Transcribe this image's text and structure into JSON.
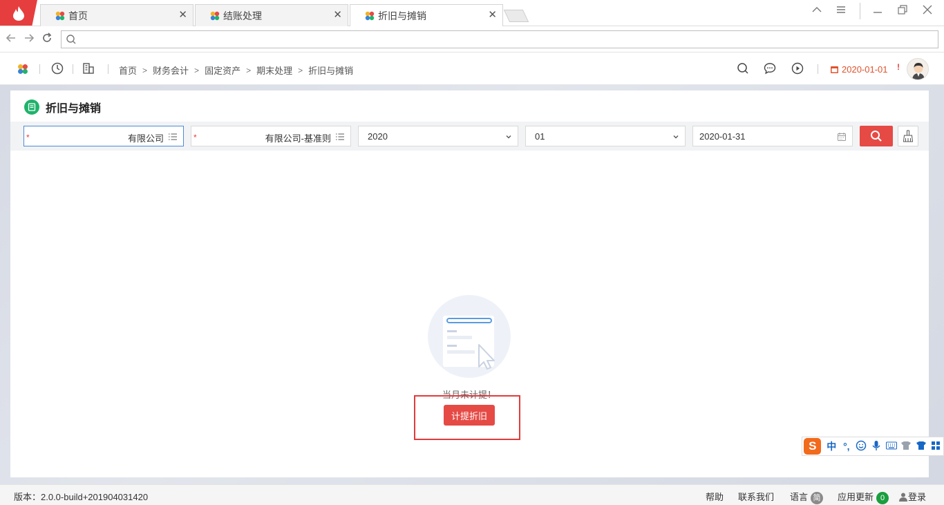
{
  "tabs": [
    {
      "label": "首页",
      "active": false
    },
    {
      "label": "结账处理",
      "active": false
    },
    {
      "label": "折旧与摊销",
      "active": true
    }
  ],
  "address": {
    "value": "",
    "placeholder": ""
  },
  "breadcrumb": [
    "首页",
    "财务会计",
    "固定资产",
    "期末处理",
    "折旧与摊销"
  ],
  "header": {
    "date": "2020-01-01",
    "warning": "!"
  },
  "panel": {
    "title": "折旧与摊销"
  },
  "filters": {
    "company": "有限公司",
    "book": "有限公司-基准则",
    "year": "2020",
    "period": "01",
    "end_date": "2020-01-31"
  },
  "empty_state": {
    "message": "当月未计提！",
    "action_label": "计提折旧"
  },
  "ime": {
    "items": [
      "中",
      "°,"
    ]
  },
  "statusbar": {
    "version": "版本：2.0.0-build+201904031420",
    "help": "帮助",
    "contact": "联系我们",
    "language": "语言",
    "language_badge": "简",
    "updates": "应用更新",
    "updates_count": "0",
    "login": "登录"
  },
  "colors": {
    "accent": "#e64a45",
    "date": "#e0522c",
    "highlight": "#e23a3a"
  }
}
